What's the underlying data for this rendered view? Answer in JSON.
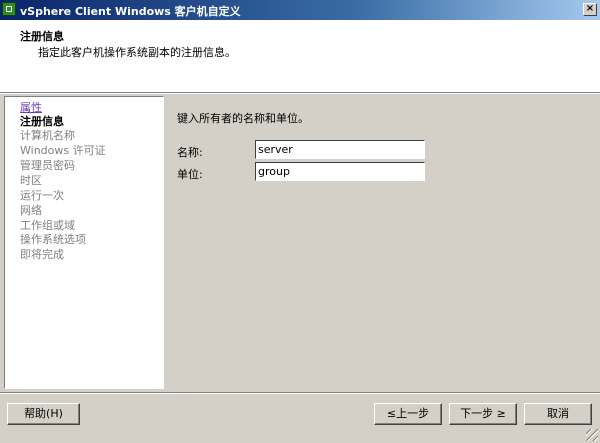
{
  "window": {
    "title": "vSphere Client Windows 客户机自定义",
    "close_glyph": "×"
  },
  "header": {
    "title": "注册信息",
    "subtitle": "指定此客户机操作系统副本的注册信息。"
  },
  "nav": {
    "items": [
      {
        "label": "属性",
        "state": "link"
      },
      {
        "label": "注册信息",
        "state": "current"
      },
      {
        "label": "计算机名称",
        "state": "disabled"
      },
      {
        "label": "Windows 许可证",
        "state": "disabled"
      },
      {
        "label": "管理员密码",
        "state": "disabled"
      },
      {
        "label": "时区",
        "state": "disabled"
      },
      {
        "label": "运行一次",
        "state": "disabled"
      },
      {
        "label": "网络",
        "state": "disabled"
      },
      {
        "label": "工作组或域",
        "state": "disabled"
      },
      {
        "label": "操作系统选项",
        "state": "disabled"
      },
      {
        "label": "即将完成",
        "state": "disabled"
      }
    ]
  },
  "form": {
    "instruction": "键入所有者的名称和单位。",
    "name_label": "名称:",
    "name_value": "server",
    "org_label": "单位:",
    "org_value": "group"
  },
  "buttons": {
    "help": "帮助(H)",
    "back": "≤上一步",
    "next": "下一步 ≥",
    "cancel": "取消"
  },
  "colors": {
    "titlebar_start": "#0a246a",
    "link": "#6a3bbf",
    "disabled": "#808080"
  }
}
